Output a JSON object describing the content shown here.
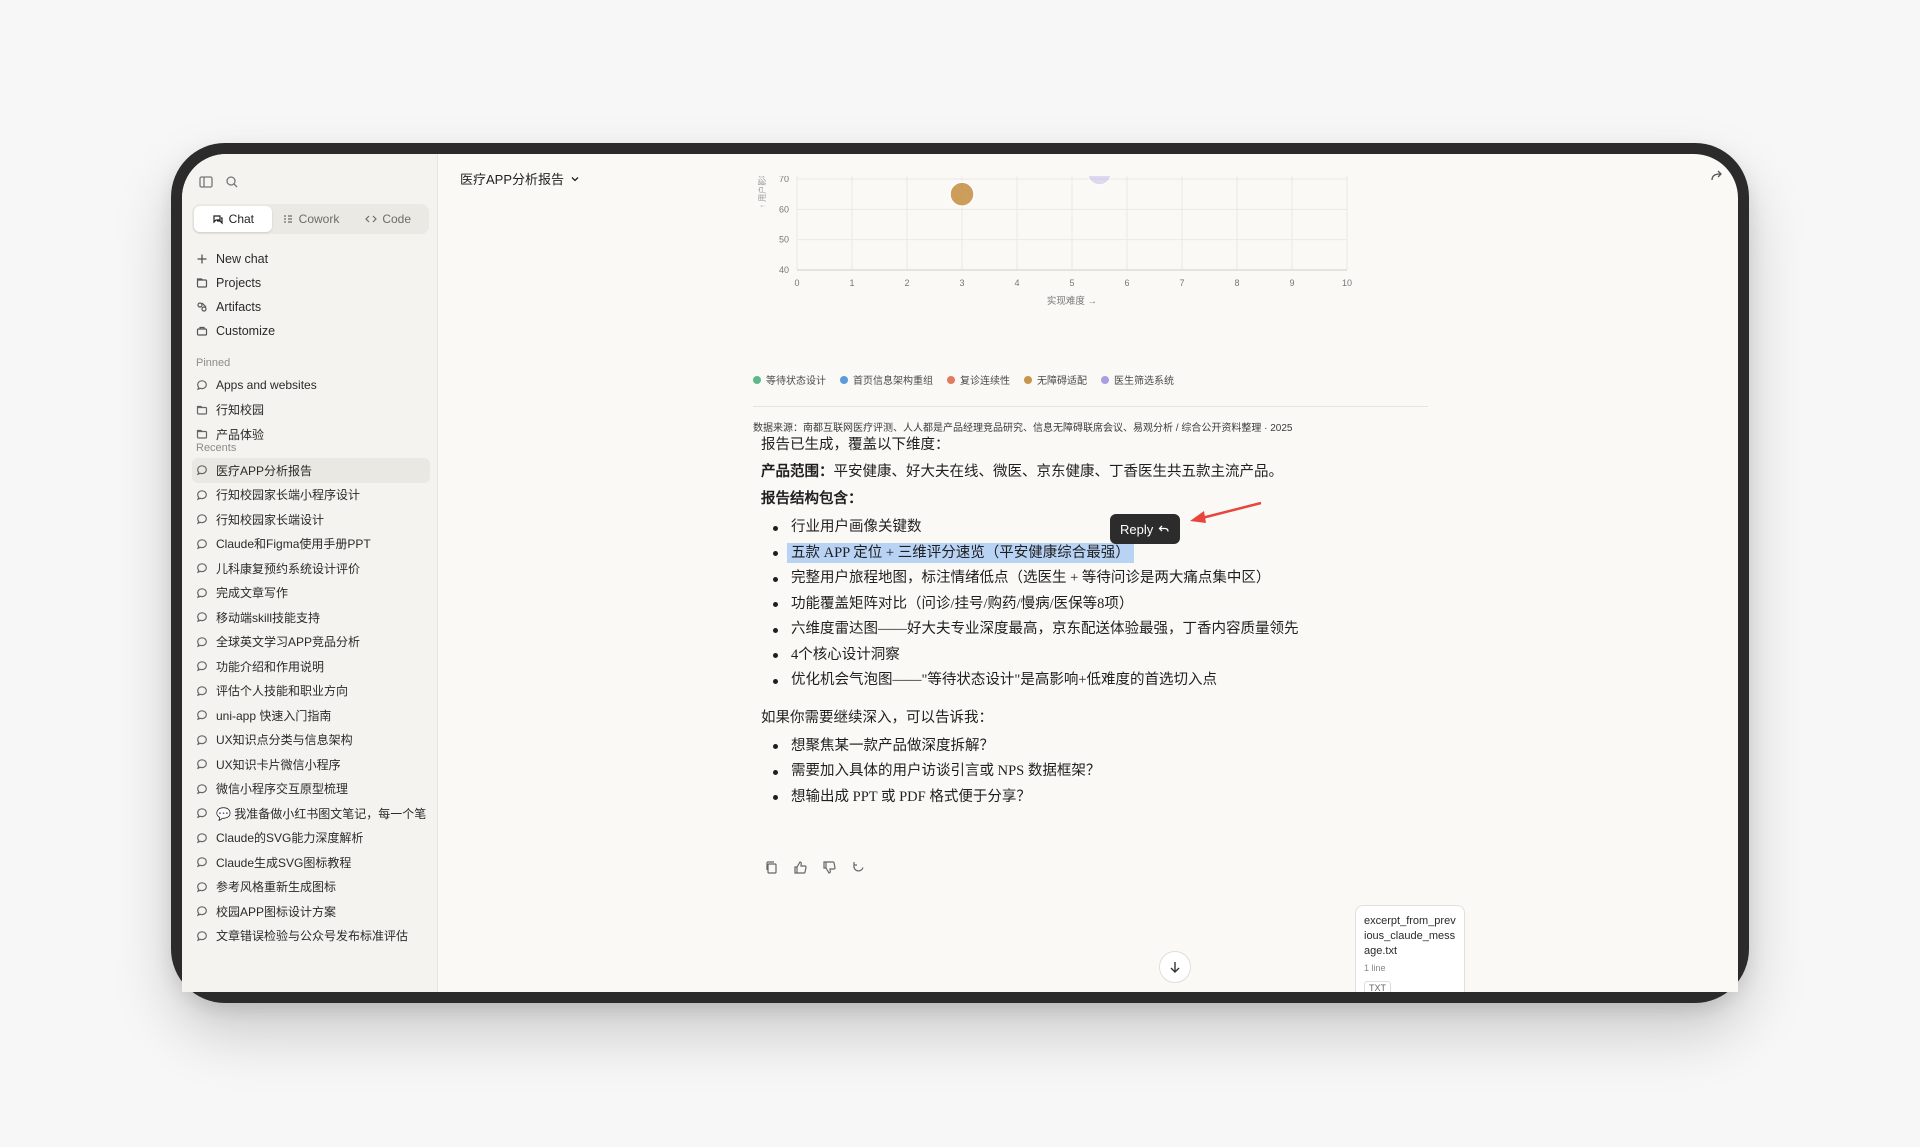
{
  "sidebar": {
    "modes": [
      {
        "label": "Chat",
        "icon": "chat-icon",
        "active": true
      },
      {
        "label": "Cowork",
        "icon": "cowork-icon",
        "active": false
      },
      {
        "label": "Code",
        "icon": "code-icon",
        "active": false
      }
    ],
    "nav": [
      {
        "label": "New chat",
        "icon": "plus-icon"
      },
      {
        "label": "Projects",
        "icon": "folder-icon"
      },
      {
        "label": "Artifacts",
        "icon": "artifacts-icon"
      },
      {
        "label": "Customize",
        "icon": "customize-icon"
      }
    ],
    "pinned_label": "Pinned",
    "pinned": [
      {
        "label": "Apps and websites",
        "icon": "chat-bubble-icon"
      },
      {
        "label": "行知校园",
        "icon": "folder-icon"
      },
      {
        "label": "产品体验",
        "icon": "folder-icon"
      }
    ],
    "recents_label": "Recents",
    "recents": [
      "医疗APP分析报告",
      "行知校园家长端小程序设计",
      "行知校园家长端设计",
      "Claude和Figma使用手册PPT",
      "儿科康复预约系统设计评价",
      "完成文章写作",
      "移动端skill技能支持",
      "全球英文学习APP竞品分析",
      "功能介绍和作用说明",
      "评估个人技能和职业方向",
      "uni-app 快速入门指南",
      "UX知识点分类与信息架构",
      "UX知识卡片微信小程序",
      "微信小程序交互原型梳理",
      "💬 我准备做小红书图文笔记，每一个笔",
      "Claude的SVG能力深度解析",
      "Claude生成SVG图标教程",
      "参考风格重新生成图标",
      "校园APP图标设计方案",
      "文章错误检验与公众号发布标准评估"
    ],
    "active_recent": 0
  },
  "header": {
    "title": "医疗APP分析报告"
  },
  "chart_data": {
    "type": "scatter",
    "xlabel": "实现难度 →",
    "ylabel": "↑ 用户影响",
    "xlim": [
      0,
      10
    ],
    "ylim": [
      40,
      70
    ],
    "x_ticks": [
      "0",
      "1",
      "2",
      "3",
      "4",
      "5",
      "6",
      "7",
      "8",
      "9",
      "10"
    ],
    "y_ticks": [
      "40",
      "50",
      "60",
      "70"
    ],
    "series": [
      {
        "name": "等待状态设计",
        "color": "#5fb88a",
        "points": []
      },
      {
        "name": "首页信息架构重组",
        "color": "#5b9bdc",
        "points": []
      },
      {
        "name": "复诊连续性",
        "color": "#e07b5f",
        "points": []
      },
      {
        "name": "无障碍适配",
        "color": "#c9944b",
        "points": [
          {
            "x": 3,
            "y": 65
          }
        ]
      },
      {
        "name": "医生筛选系统",
        "color": "#a99ee0",
        "points": [
          {
            "x": 5.5,
            "y": 72
          }
        ]
      }
    ]
  },
  "source_note": "数据来源：南都互联网医疗评测、人人都是产品经理竞品研究、信息无障碍联席会议、易观分析 / 综合公开资料整理 · 2025",
  "message": {
    "intro": "报告已生成，覆盖以下维度：",
    "scope_label": "产品范围：",
    "scope_text": "平安健康、好大夫在线、微医、京东健康、丁香医生共五款主流产品。",
    "structure_label": "报告结构包含：",
    "structure_items": [
      "行业用户画像关键数",
      "五款 APP 定位 + 三维评分速览（平安健康综合最强）",
      "完整用户旅程地图，标注情绪低点（选医生 + 等待问诊是两大痛点集中区）",
      "功能覆盖矩阵对比（问诊/挂号/购药/慢病/医保等8项）",
      "六维度雷达图——好大夫专业深度最高，京东配送体验最强，丁香内容质量领先",
      "4个核心设计洞察",
      "优化机会气泡图——\"等待状态设计\"是高影响+低难度的首选切入点"
    ],
    "followup": "如果你需要继续深入，可以告诉我：",
    "followup_items": [
      "想聚焦某一款产品做深度拆解？",
      "需要加入具体的用户访谈引言或 NPS 数据框架？",
      "想输出成 PPT 或 PDF 格式便于分享？"
    ]
  },
  "reply_button": {
    "label": "Reply"
  },
  "attachment": {
    "name": "excerpt_from_previous_claude_message.txt",
    "meta": "1 line",
    "ext": "TXT"
  }
}
